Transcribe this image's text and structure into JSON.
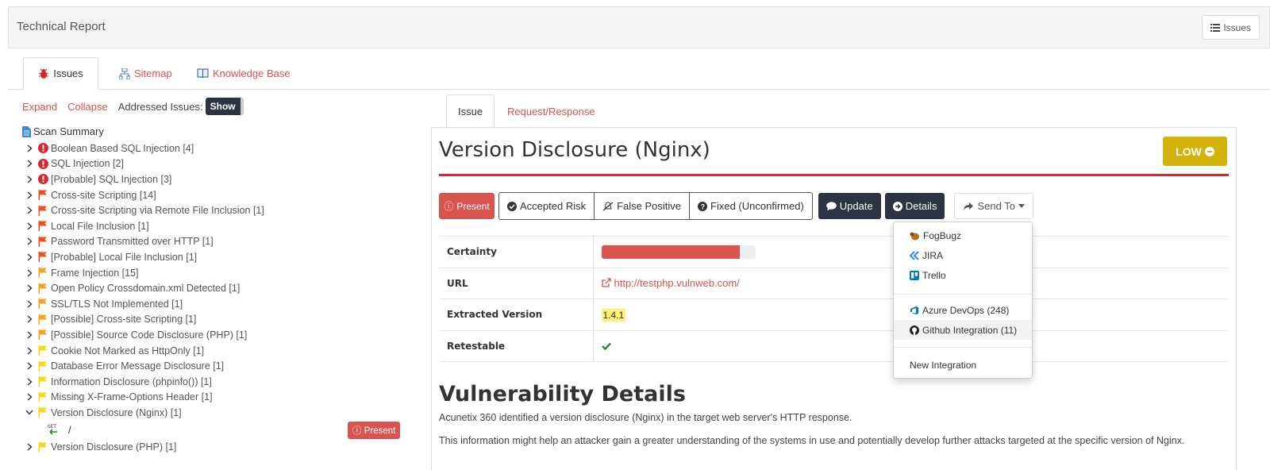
{
  "header": {
    "title": "Technical Report",
    "issues_button": "Issues"
  },
  "main_tabs": [
    {
      "label": "Issues",
      "icon": "bug-icon"
    },
    {
      "label": "Sitemap",
      "icon": "sitemap-icon"
    },
    {
      "label": "Knowledge Base",
      "icon": "book-icon"
    }
  ],
  "tree_controls": {
    "expand": "Expand",
    "collapse": "Collapse",
    "addressed_label": "Addressed Issues:",
    "show": "Show"
  },
  "scan_summary": "Scan Summary",
  "tree": [
    {
      "label": "Boolean Based SQL Injection [4]",
      "severity": "critical"
    },
    {
      "label": "SQL Injection [2]",
      "severity": "critical"
    },
    {
      "label": "[Probable] SQL Injection [3]",
      "severity": "critical"
    },
    {
      "label": "Cross-site Scripting [14]",
      "severity": "high"
    },
    {
      "label": "Cross-site Scripting via Remote File Inclusion [1]",
      "severity": "high"
    },
    {
      "label": "Local File Inclusion [1]",
      "severity": "high"
    },
    {
      "label": "Password Transmitted over HTTP [1]",
      "severity": "high"
    },
    {
      "label": "[Probable] Local File Inclusion [1]",
      "severity": "high"
    },
    {
      "label": "Frame Injection [15]",
      "severity": "medium"
    },
    {
      "label": "Open Policy Crossdomain.xml Detected [1]",
      "severity": "medium"
    },
    {
      "label": "SSL/TLS Not Implemented [1]",
      "severity": "medium"
    },
    {
      "label": "[Possible] Cross-site Scripting [1]",
      "severity": "medium"
    },
    {
      "label": "[Possible] Source Code Disclosure (PHP) [1]",
      "severity": "medium"
    },
    {
      "label": "Cookie Not Marked as HttpOnly [1]",
      "severity": "low"
    },
    {
      "label": "Database Error Message Disclosure [1]",
      "severity": "low"
    },
    {
      "label": "Information Disclosure (phpinfo()) [1]",
      "severity": "low"
    },
    {
      "label": "Missing X-Frame-Options Header [1]",
      "severity": "low"
    },
    {
      "label": "Version Disclosure (Nginx) [1]",
      "severity": "low",
      "expanded": true
    }
  ],
  "tree_sub": {
    "method": "GET",
    "path": "/",
    "status": "Present"
  },
  "tree_after": [
    {
      "label": "Version Disclosure (PHP) [1]",
      "severity": "low"
    }
  ],
  "detail_tabs": [
    "Issue",
    "Request/Response"
  ],
  "vuln": {
    "title": "Version Disclosure (Nginx)",
    "severity": "LOW",
    "status_present": "Present",
    "status_buttons": [
      "Accepted Risk",
      "False Positive",
      "Fixed (Unconfirmed)"
    ],
    "update": "Update",
    "details": "Details",
    "send_to": "Send To"
  },
  "properties": {
    "certainty_label": "Certainty",
    "certainty_value": 0.9,
    "url_label": "URL",
    "url": "http://testphp.vulnweb.com/",
    "version_label": "Extracted Version",
    "version": "1.4.1",
    "retestable_label": "Retestable"
  },
  "details_section": {
    "title": "Vulnerability Details",
    "p1": "Acunetix 360 identified a version disclosure (Nginx) in the target web server's HTTP response.",
    "p2": "This information might help an attacker gain a greater understanding of the systems in use and potentially develop further attacks targeted at the specific version of Nginx."
  },
  "send_to_menu": {
    "group1": [
      "FogBugz",
      "JIRA",
      "Trello"
    ],
    "group2": [
      "Azure DevOps (248)",
      "Github Integration (11)"
    ],
    "new": "New Integration"
  },
  "colors": {
    "accent": "#d9534f",
    "dark": "#2d3343",
    "low": "#d3b30a",
    "critical": "#d9272e",
    "high": "#f0501f",
    "medium": "#f7a21c",
    "low_flag": "#f5d915"
  }
}
